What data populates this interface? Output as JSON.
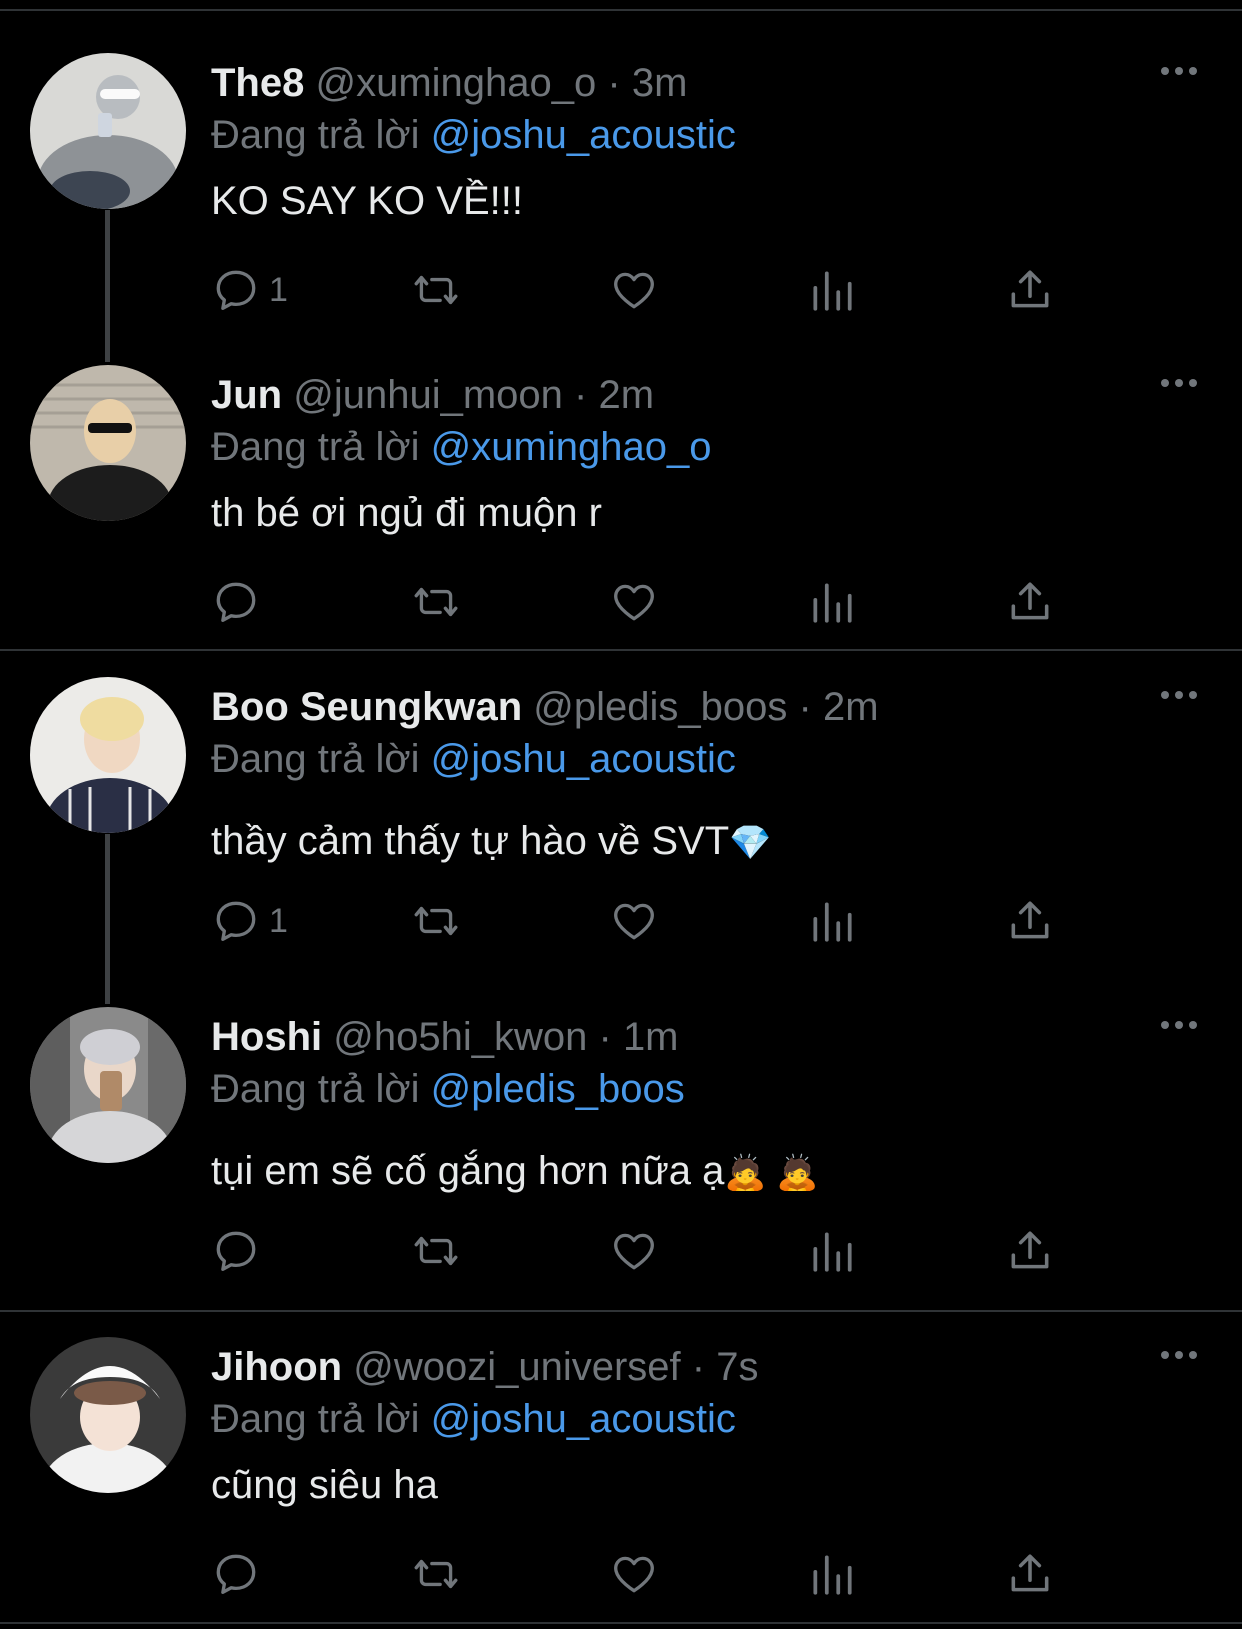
{
  "colors": {
    "background": "#000000",
    "text": "#e7e9ea",
    "muted": "#71767b",
    "mention": "#4a99e9",
    "separator": "#2f3336",
    "thread_line": "#3e4144"
  },
  "tweets": [
    {
      "name": "The8",
      "handle": "@xuminghao_o",
      "dot": "·",
      "time": "3m",
      "reply_prefix": "Đang trả lời",
      "reply_to": "@joshu_acoustic",
      "text": "KO SAY KO VỀ!!!",
      "reply_count": "1",
      "icons": {
        "reply": "reply-icon",
        "retweet": "retweet-icon",
        "like": "heart-icon",
        "views": "views-icon",
        "share": "share-icon",
        "more": "more-icon"
      }
    },
    {
      "name": "Jun",
      "handle": "@junhui_moon",
      "dot": "·",
      "time": "2m",
      "reply_prefix": "Đang trả lời",
      "reply_to": "@xuminghao_o",
      "text": "th bé ơi ngủ đi muộn r",
      "reply_count": ""
    },
    {
      "name": "Boo Seungkwan",
      "handle": "@pledis_boos",
      "dot": "·",
      "time": "2m",
      "reply_prefix": "Đang trả lời",
      "reply_to": "@joshu_acoustic",
      "text": "thầy cảm thấy tự hào về SVT",
      "emoji": "💎",
      "reply_count": "1"
    },
    {
      "name": "Hoshi",
      "handle": "@ho5hi_kwon",
      "dot": "·",
      "time": "1m",
      "reply_prefix": "Đang trả lời",
      "reply_to": "@pledis_boos",
      "text": "tụi em sẽ cố gắng hơn nữa ạ",
      "emoji": "🙇 🙇",
      "reply_count": ""
    },
    {
      "name": "Jihoon",
      "handle": "@woozi_universef",
      "dot": "·",
      "time": "7s",
      "reply_prefix": "Đang trả lời",
      "reply_to": "@joshu_acoustic",
      "text": "cũng siêu ha",
      "reply_count": ""
    }
  ]
}
